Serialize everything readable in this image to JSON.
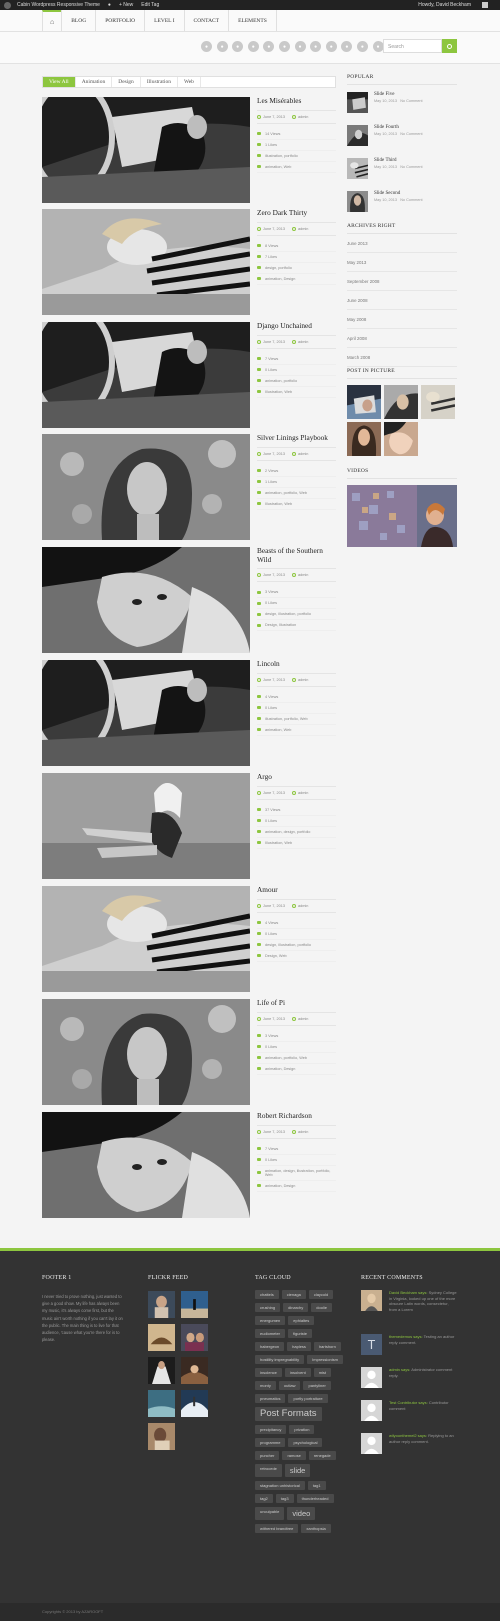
{
  "admin_bar": {
    "site_name": "Cabin Wordpress Responsive Theme",
    "new_label": "+ New",
    "edit_label": "Edit Tag",
    "howdy": "Howdy, David Beckham"
  },
  "nav": {
    "items": [
      "BLOG",
      "PORTFOLIO",
      "LEVEL I",
      "CONTACT",
      "ELEMENTS"
    ]
  },
  "social_icons": [
    "rss-icon",
    "facebook-icon",
    "twitter-icon",
    "dribbble-icon",
    "google-plus-icon",
    "flickr-icon",
    "linkedin-icon",
    "pinterest-icon",
    "youtube-icon",
    "skype-icon",
    "vimeo-icon",
    "email-icon",
    "vk-icon"
  ],
  "search": {
    "placeholder": "Search"
  },
  "filters": [
    "View All",
    "Animation",
    "Design",
    "Illustration",
    "Web"
  ],
  "posts": [
    {
      "title": "Les Misérables",
      "date": "June 7, 2013",
      "author": "admin",
      "views": "14 Views",
      "likes": "1 Likes",
      "tags": "illustration, portfolio",
      "cats": "animation, Web",
      "img": "car"
    },
    {
      "title": "Zero Dark Thirty",
      "date": "June 7, 2013",
      "author": "admin",
      "views": "8 Views",
      "likes": "7 Likes",
      "tags": "design, portfolio",
      "cats": "animation, Design",
      "img": "stripes"
    },
    {
      "title": "Django Unchained",
      "date": "June 7, 2013",
      "author": "admin",
      "views": "7 Views",
      "likes": "0 Likes",
      "tags": "animation, portfolio",
      "cats": "Illustration, Web",
      "img": "car"
    },
    {
      "title": "Silver Linings Playbook",
      "date": "June 7, 2013",
      "author": "admin",
      "views": "2 Views",
      "likes": "1 Likes",
      "tags": "animation, portfolio, Web",
      "cats": "Illustration, Web",
      "img": "curly"
    },
    {
      "title": "Beasts of the Southern Wild",
      "date": "June 7, 2013",
      "author": "admin",
      "views": "3 Views",
      "likes": "0 Likes",
      "tags": "design, illustration, portfolio",
      "cats": "Design, Illustration",
      "img": "hat"
    },
    {
      "title": "Lincoln",
      "date": "June 7, 2013",
      "author": "admin",
      "views": "4 Views",
      "likes": "0 Likes",
      "tags": "illustration, portfolio, Web",
      "cats": "animation, Web",
      "img": "car"
    },
    {
      "title": "Argo",
      "date": "June 7, 2013",
      "author": "admin",
      "views": "37 Views",
      "likes": "0 Likes",
      "tags": "animation, design, portfolio",
      "cats": "Illustration, Web",
      "img": "sit"
    },
    {
      "title": "Amour",
      "date": "June 7, 2013",
      "author": "admin",
      "views": "4 Views",
      "likes": "0 Likes",
      "tags": "design, illustration, portfolio",
      "cats": "Design, Web",
      "img": "stripes"
    },
    {
      "title": "Life of Pi",
      "date": "June 7, 2013",
      "author": "admin",
      "views": "3 Views",
      "likes": "0 Likes",
      "tags": "animation, portfolio, Web",
      "cats": "animation, Design",
      "img": "curly"
    },
    {
      "title": "Robert Richardson",
      "date": "June 7, 2013",
      "author": "admin",
      "views": "7 Views",
      "likes": "0 Likes",
      "tags": "animation, design, illustration, portfolio, Web",
      "cats": "animation, Design",
      "img": "hat"
    }
  ],
  "sidebar": {
    "popular_heading": "POPULAR",
    "popular": [
      {
        "title": "Slide Five",
        "date": "May 10, 2013",
        "comments": "No Comment"
      },
      {
        "title": "Slide Fourth",
        "date": "May 10, 2013",
        "comments": "No Comment"
      },
      {
        "title": "Slide Third",
        "date": "May 10, 2013",
        "comments": "No Comment"
      },
      {
        "title": "Slide Second",
        "date": "May 10, 2013",
        "comments": "No Comment"
      }
    ],
    "archives_heading": "ARCHIVES RIGHT",
    "archives": [
      "June 2013",
      "May 2013",
      "September 2008",
      "June 2008",
      "May 2008",
      "April 2008",
      "March 2008"
    ],
    "pip_heading": "POST IN PICTURE",
    "videos_heading": "VIDEOS"
  },
  "footer": {
    "footer1_heading": "FOOTER 1",
    "footer1_text": "I never tried to prove nothing, just wanted to give a good show. My life has always been my music, it's always come first, but the music ain't worth nothing if you can't lay it on the public. The main thing is to live for that audience, 'cause what you're there for is to please.",
    "flickr_heading": "FLICKR FEED",
    "tags_heading": "TAG CLOUD",
    "tags": [
      {
        "t": "chattels",
        "s": "n"
      },
      {
        "t": "cienaga",
        "s": "n"
      },
      {
        "t": "claycold",
        "s": "n"
      },
      {
        "t": "crushing",
        "s": "n"
      },
      {
        "t": "dinarchy",
        "s": "n"
      },
      {
        "t": "doolie",
        "s": "n"
      },
      {
        "t": "energumen",
        "s": "n"
      },
      {
        "t": "ephialtes",
        "s": "n"
      },
      {
        "t": "eudiometer",
        "s": "n"
      },
      {
        "t": "figuriste",
        "s": "n"
      },
      {
        "t": "habergeon",
        "s": "n"
      },
      {
        "t": "hapless",
        "s": "n"
      },
      {
        "t": "hartshorn",
        "s": "n"
      },
      {
        "t": "hostility impregnability",
        "s": "n"
      },
      {
        "t": "Impressionism",
        "s": "n"
      },
      {
        "t": "insolence",
        "s": "n"
      },
      {
        "t": "insolvent",
        "s": "n"
      },
      {
        "t": "mist",
        "s": "n"
      },
      {
        "t": "monty",
        "s": "n"
      },
      {
        "t": "outlaw",
        "s": "n"
      },
      {
        "t": "pantyliner",
        "s": "n"
      },
      {
        "t": "pneumatics",
        "s": "n"
      },
      {
        "t": "portly portraiture",
        "s": "n"
      },
      {
        "t": "Post Formats",
        "s": "big"
      },
      {
        "t": "precipitancy",
        "s": "n"
      },
      {
        "t": "privation",
        "s": "n"
      },
      {
        "t": "programme",
        "s": "n"
      },
      {
        "t": "psychological",
        "s": "n"
      },
      {
        "t": "puncher",
        "s": "n"
      },
      {
        "t": "ramose",
        "s": "n"
      },
      {
        "t": "renegade",
        "s": "n"
      },
      {
        "t": "retrocede",
        "s": "n"
      },
      {
        "t": "slide",
        "s": "mid"
      },
      {
        "t": "stagnation unhistorical",
        "s": "n"
      },
      {
        "t": "tag1",
        "s": "n"
      },
      {
        "t": "tag2",
        "s": "n"
      },
      {
        "t": "tag3",
        "s": "n"
      },
      {
        "t": "thunderheaded",
        "s": "n"
      },
      {
        "t": "unculpable",
        "s": "n"
      },
      {
        "t": "video",
        "s": "mid"
      },
      {
        "t": "withered brandtree",
        "s": "n"
      },
      {
        "t": "xanthopsia",
        "s": "n"
      }
    ],
    "rc_heading": "RECENT COMMENTS",
    "recent_comments": [
      {
        "author": "David Beckham says:",
        "text": "Sydney College in Virginia, looked up one of the more obscure Latin words, consectetur, from a Lorem"
      },
      {
        "author": "themedemos says:",
        "text": "Testing an author reply comment."
      },
      {
        "author": "admin says:",
        "text": "Administrator comment reply."
      },
      {
        "author": "Test Contributor says:",
        "text": "Contributor comment"
      },
      {
        "author": "wilyoonthemel2 says:",
        "text": "Replying to an author reply comment."
      }
    ],
    "copyright": "Copyrights © 2013 by AZAROOFT"
  }
}
